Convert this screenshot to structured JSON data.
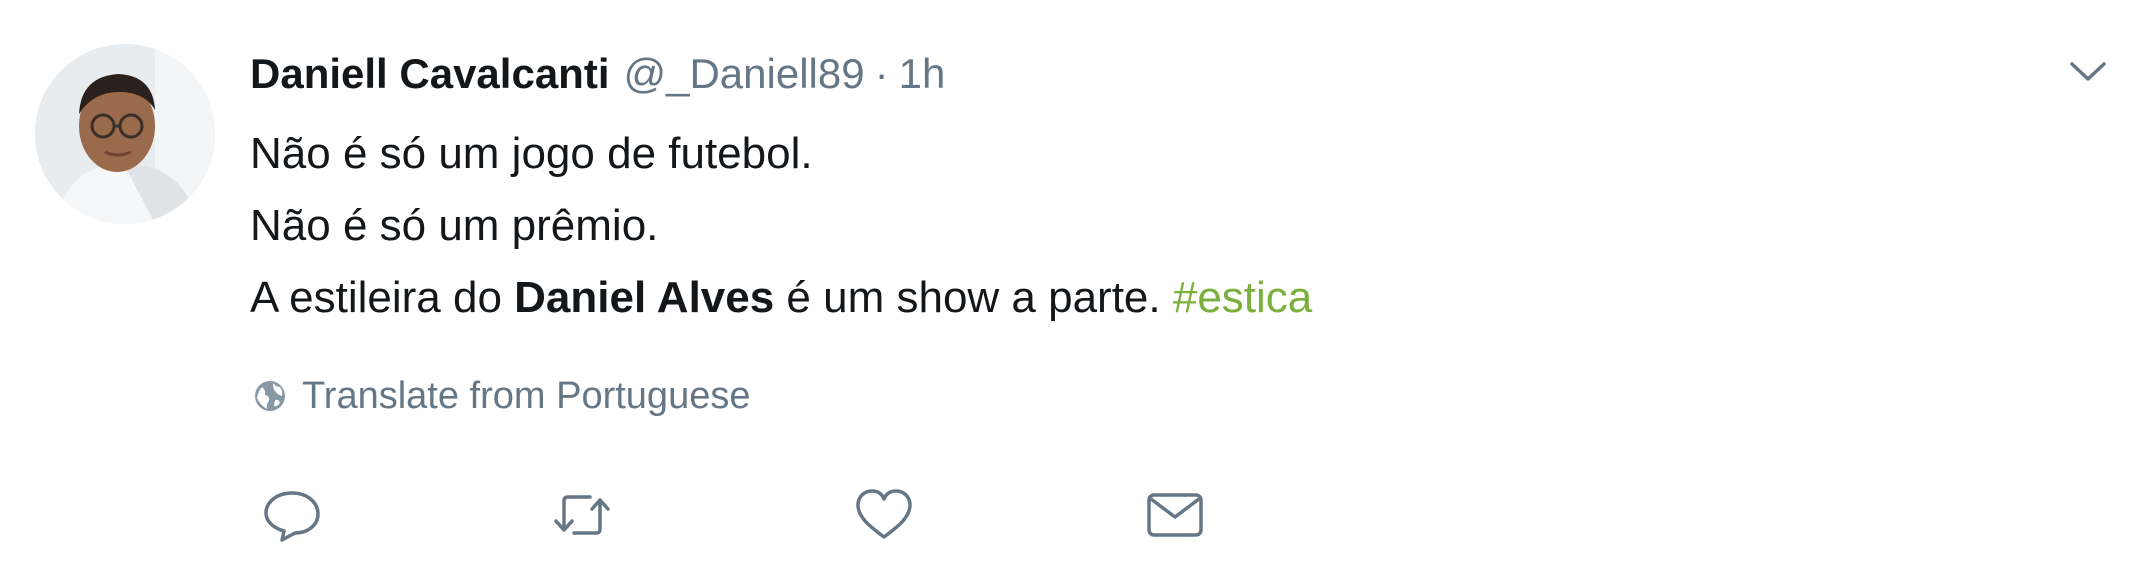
{
  "tweet": {
    "author": {
      "display_name": "Daniell Cavalcanti",
      "handle": "@_Daniell89",
      "separator": "·",
      "time": "1h"
    },
    "lines": [
      {
        "text": "Não é só um jogo de futebol."
      },
      {
        "text": "Não é só um prêmio."
      },
      {
        "prefix": "A estileira do ",
        "mention": "Daniel Alves",
        "middle": " é um show a parte. ",
        "hashtag": "#estica"
      }
    ],
    "translate_label": "Translate from Portuguese",
    "actions": [
      "reply-icon",
      "retweet-icon",
      "like-icon",
      "direct-message-icon"
    ],
    "icons": {
      "menu": "chevron-down-icon",
      "translate": "globe-icon"
    },
    "colors": {
      "text": "#14171a",
      "secondary": "#657786",
      "hashtag": "#7ab03b"
    }
  }
}
